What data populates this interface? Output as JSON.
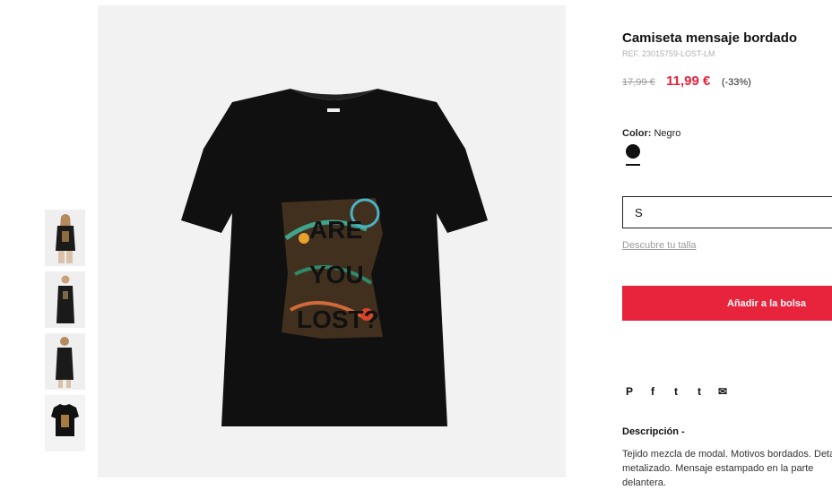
{
  "thumbnails": [
    {
      "icon": "model-front-photo"
    },
    {
      "icon": "model-long-photo"
    },
    {
      "icon": "model-back-photo"
    },
    {
      "icon": "tshirt-flat-photo"
    }
  ],
  "main_image": {
    "icon": "tshirt-product-photo",
    "print_text": [
      "ARE",
      "YOU",
      "LOST?"
    ]
  },
  "product": {
    "title": "Camiseta mensaje bordado",
    "ref": "REF. 23015759-LOST-LM",
    "old_price": "17,99 €",
    "new_price": "11,99 €",
    "discount": "(-33%)",
    "color_label": "Color:",
    "color_value": "Negro",
    "swatch_color": "#111111",
    "size_value": "S",
    "size_link": "Descubre tu talla",
    "add_button": "Añadir a la bolsa"
  },
  "share": [
    {
      "icon": "pinterest-icon",
      "glyph": "P"
    },
    {
      "icon": "facebook-icon",
      "glyph": "f"
    },
    {
      "icon": "twitter-icon",
      "glyph": "t"
    },
    {
      "icon": "tumblr-icon",
      "glyph": "t"
    },
    {
      "icon": "email-icon",
      "glyph": "✉"
    }
  ],
  "description": {
    "title": "Descripción -",
    "text": "Tejido mezcla de modal. Motivos bordados. Detalle metalizado. Mensaje estampado en la parte delantera."
  },
  "colors": {
    "accent": "#e8233c",
    "price_red": "#e8203a",
    "image_bg": "#f2f2f2"
  }
}
